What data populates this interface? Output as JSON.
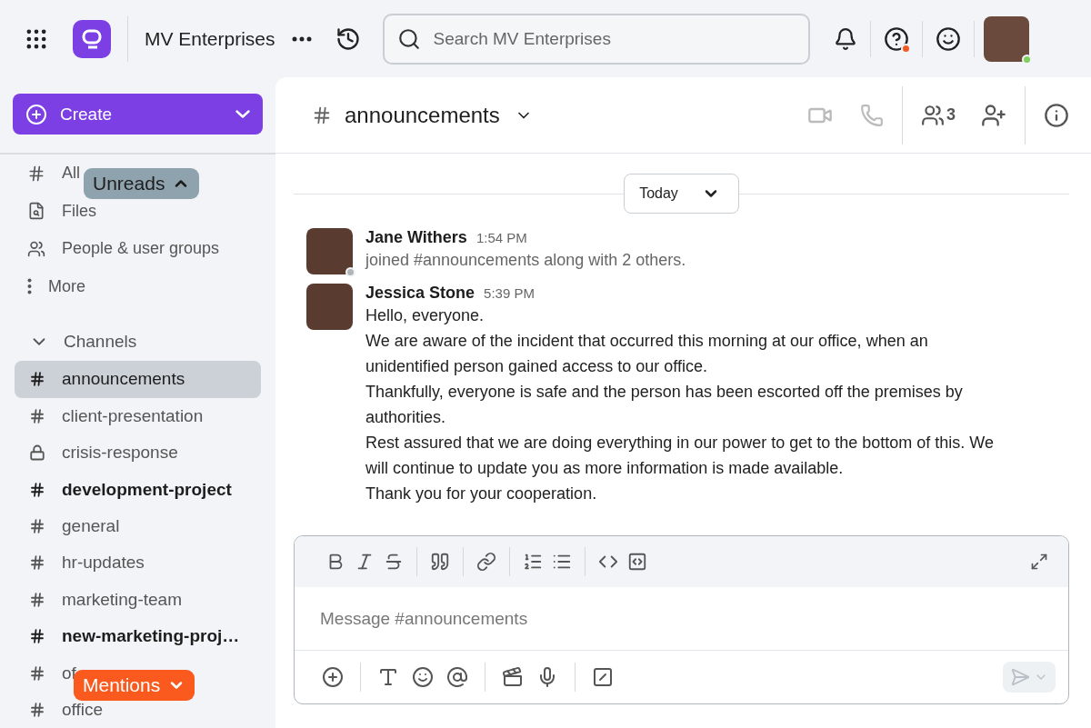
{
  "topbar": {
    "workspace": "MV Enterprises",
    "search_placeholder": "Search MV Enterprises",
    "help_alert": true,
    "user_online": true
  },
  "sidebar": {
    "create": "Create",
    "nav": [
      {
        "kind": "channels",
        "label": "All"
      },
      {
        "kind": "files",
        "label": "Files"
      },
      {
        "kind": "people",
        "label": "People & user groups"
      },
      {
        "kind": "more",
        "label": "More"
      }
    ],
    "section": {
      "label": "Channels",
      "expanded": true
    },
    "channels": [
      {
        "name": "announcements",
        "kind": "public",
        "selected": true,
        "unread": false
      },
      {
        "name": "client-presentation",
        "kind": "public",
        "selected": false,
        "unread": false
      },
      {
        "name": "crisis-response",
        "kind": "private",
        "selected": false,
        "unread": false
      },
      {
        "name": "development-project",
        "kind": "public",
        "selected": false,
        "unread": true
      },
      {
        "name": "general",
        "kind": "public",
        "selected": false,
        "unread": false
      },
      {
        "name": "hr-updates",
        "kind": "public",
        "selected": false,
        "unread": false
      },
      {
        "name": "marketing-team",
        "kind": "public",
        "selected": false,
        "unread": false
      },
      {
        "name": "new-marketing-proj…",
        "kind": "public",
        "selected": false,
        "unread": true
      },
      {
        "name": "of",
        "kind": "public",
        "selected": false,
        "unread": false
      },
      {
        "name": "office",
        "kind": "public",
        "selected": false,
        "unread": false
      }
    ],
    "unreads_badge": "Unreads",
    "mentions_badge": "Mentions"
  },
  "channel_header": {
    "name": "announcements",
    "members": "3"
  },
  "date_divider": "Today",
  "messages": [
    {
      "author": "Jane Withers",
      "time": "1:54 PM",
      "away": true,
      "kind": "system",
      "lines": [
        "joined #announcements along with 2 others."
      ]
    },
    {
      "author": "Jessica Stone",
      "time": "5:39 PM",
      "away": false,
      "kind": "text",
      "lines": [
        "Hello, everyone.",
        "We are aware of the incident that occurred this morning at our office, when an unidentified person gained access to our office.",
        "Thankfully, everyone is safe and the person has been escorted off the premises by authorities.",
        "Rest assured that we are doing everything in our power to get to the bottom of this. We will continue to update you as more information is made available.",
        "Thank you for your cooperation."
      ]
    }
  ],
  "composer": {
    "placeholder": "Message #announcements"
  }
}
